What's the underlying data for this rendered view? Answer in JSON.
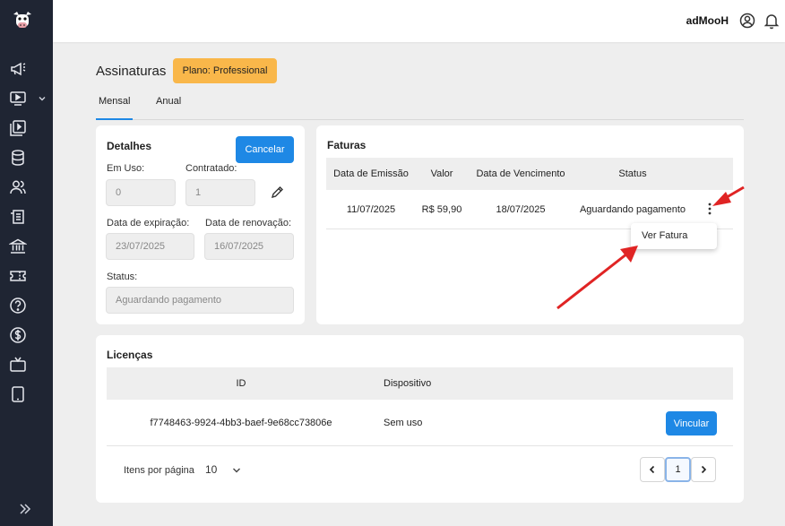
{
  "header": {
    "username": "adMooH"
  },
  "page": {
    "title": "Assinaturas",
    "plan_badge": "Plano: Professional"
  },
  "tabs": [
    {
      "label": "Mensal",
      "active": true
    },
    {
      "label": "Anual",
      "active": false
    }
  ],
  "details": {
    "title": "Detalhes",
    "cancel_label": "Cancelar",
    "in_use_label": "Em Uso:",
    "in_use_value": "0",
    "contracted_label": "Contratado:",
    "contracted_value": "1",
    "expiration_label": "Data de expiração:",
    "expiration_value": "23/07/2025",
    "renewal_label": "Data de renovação:",
    "renewal_value": "16/07/2025",
    "status_label": "Status:",
    "status_value": "Aguardando pagamento"
  },
  "invoices": {
    "title": "Faturas",
    "columns": [
      "Data de Emissão",
      "Valor",
      "Data de Vencimento",
      "Status"
    ],
    "rows": [
      {
        "issue_date": "11/07/2025",
        "amount": "R$ 59,90",
        "due_date": "18/07/2025",
        "status": "Aguardando pagamento"
      }
    ],
    "menu_item": "Ver Fatura"
  },
  "licenses": {
    "title": "Licenças",
    "columns": [
      "ID",
      "Dispositivo"
    ],
    "rows": [
      {
        "id": "f7748463-9924-4bb3-baef-9e68cc73806e",
        "device": "Sem uso",
        "action": "Vincular"
      }
    ],
    "per_page_label": "Itens por página",
    "per_page_value": "10",
    "current_page": "1"
  },
  "colors": {
    "sidebar": "#1f2533",
    "accent": "#1e88e5",
    "badge": "#f9b74a",
    "annotation_arrow": "#e02424"
  }
}
